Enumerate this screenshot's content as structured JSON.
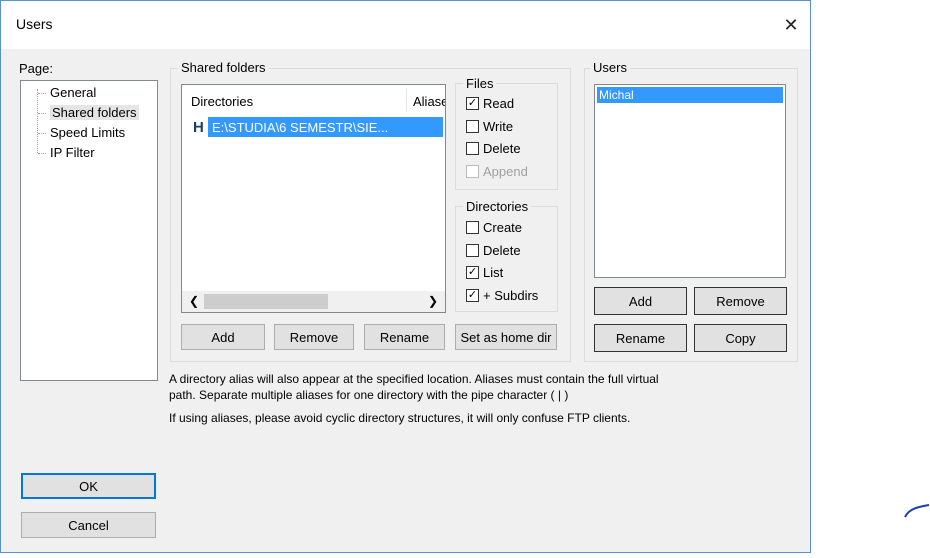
{
  "window": {
    "title": "Users"
  },
  "page_label": "Page:",
  "tree": {
    "items": [
      "General",
      "Shared folders",
      "Speed Limits",
      "IP Filter"
    ]
  },
  "shared_folders": {
    "title": "Shared folders",
    "columns": [
      "Directories",
      "Aliases"
    ],
    "row": {
      "marker": "H",
      "path": "E:\\STUDIA\\6 SEMESTR\\SIE..."
    },
    "buttons": {
      "add": "Add",
      "remove": "Remove",
      "rename": "Rename",
      "home": "Set as home dir"
    }
  },
  "files": {
    "title": "Files",
    "read": "Read",
    "write": "Write",
    "delete": "Delete",
    "append": "Append"
  },
  "directories": {
    "title": "Directories",
    "create": "Create",
    "delete": "Delete",
    "list": "List",
    "subdirs": "+ Subdirs"
  },
  "users": {
    "title": "Users",
    "list": [
      "Michal"
    ],
    "buttons": {
      "add": "Add",
      "remove": "Remove",
      "rename": "Rename",
      "copy": "Copy"
    }
  },
  "info": {
    "line1": "A directory alias will also appear at the specified location. Aliases must contain the full virtual",
    "line2": "path. Separate multiple aliases for one directory with the pipe character ( | )",
    "line3": "If using aliases, please avoid cyclic directory structures, it will only confuse FTP clients."
  },
  "footer": {
    "ok": "OK",
    "cancel": "Cancel"
  },
  "colors": {
    "selection": "#3399ff",
    "border_accent": "#0078d7"
  }
}
